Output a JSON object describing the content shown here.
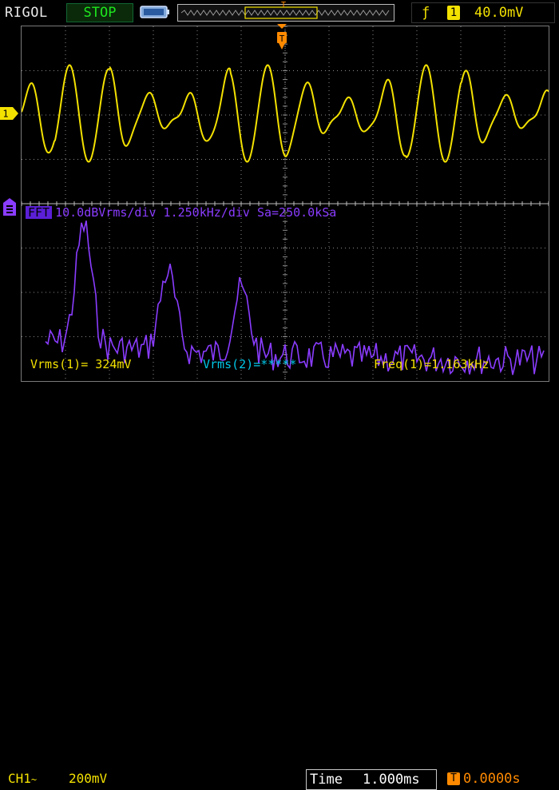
{
  "brand": "RIGOL",
  "run_status": "STOP",
  "trigger": {
    "edge_symbol": "ƒ",
    "source": "1",
    "level": "40.0mV",
    "marker": "T"
  },
  "channel1": {
    "marker": "1",
    "label": "CH1",
    "coupling_symbol": "~",
    "scale": "200mV"
  },
  "fft": {
    "tag": "FFT",
    "info": "10.0dBVrms/div  1.250kHz/div  Sa=250.0kSa"
  },
  "measurements": {
    "vrms1": "Vrms(1)= 324mV",
    "vrms2": "Vrms(2)=*****",
    "freq1": "Freq(1)=1.163kHz"
  },
  "timebase": {
    "label": "Time",
    "value": "1.000ms"
  },
  "trigger_offset": {
    "icon": "T",
    "value": "0.0000s"
  },
  "colors": {
    "ch1": "#f3e100",
    "fft": "#8a3cff",
    "ch2": "#00c8e8",
    "trigger": "#ff8a00",
    "status": "#1ee61e",
    "grid": "#8a8a8a"
  }
}
